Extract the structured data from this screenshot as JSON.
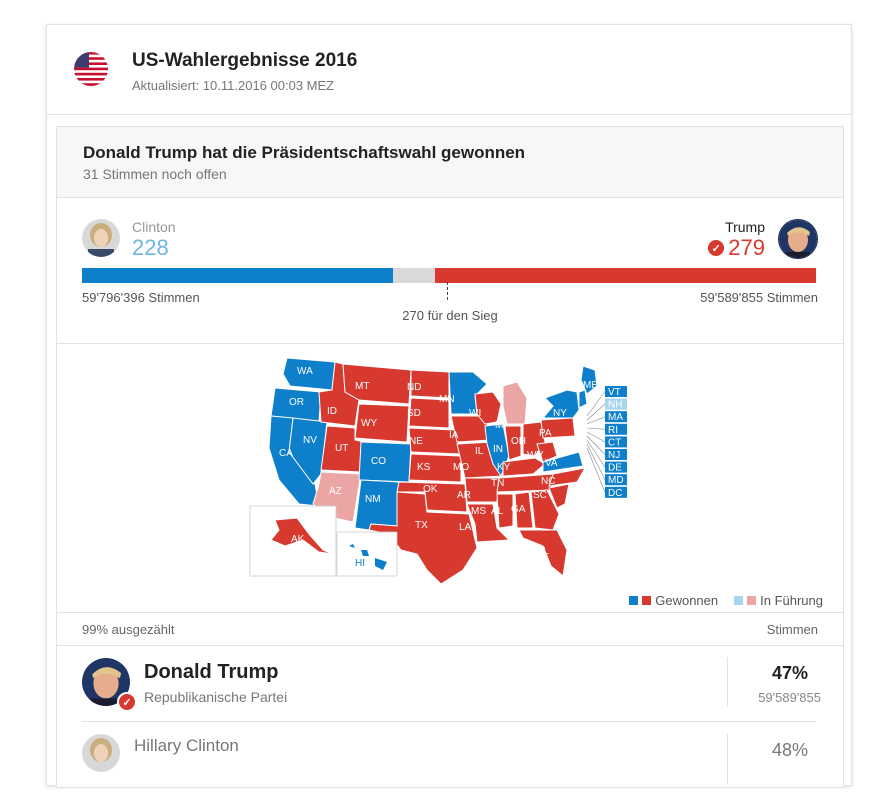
{
  "header": {
    "title": "US-Wahlergebnisse 2016",
    "updated": "Aktualisiert: 10.11.2016 00:03 MEZ"
  },
  "winner": {
    "headline": "Donald Trump hat die Präsidentschaftswahl gewonnen",
    "open_votes": "31 Stimmen noch offen"
  },
  "tally": {
    "clinton": {
      "name": "Clinton",
      "electoral": "228",
      "popular": "59'796'396 Stimmen"
    },
    "trump": {
      "name": "Trump",
      "electoral": "279",
      "popular": "59'589'855 Stimmen"
    },
    "to_win": "270 für den Sieg",
    "total_electoral": 538
  },
  "colors": {
    "dem": "#0d7fcb",
    "rep": "#d7392e",
    "dem_lead": "#a8d4f0",
    "rep_lead": "#eca5a5",
    "open": "#d9d9d9"
  },
  "map": {
    "states": [
      "WA",
      "OR",
      "CA",
      "NV",
      "ID",
      "MT",
      "WY",
      "UT",
      "AZ",
      "CO",
      "NM",
      "ND",
      "SD",
      "NE",
      "KS",
      "OK",
      "TX",
      "MN",
      "IA",
      "MO",
      "AR",
      "LA",
      "WI",
      "IL",
      "MI",
      "IN",
      "OH",
      "KY",
      "TN",
      "MS",
      "AL",
      "GA",
      "FL",
      "SC",
      "NC",
      "VA",
      "WV",
      "PA",
      "NY",
      "ME",
      "AK",
      "HI",
      "VT",
      "NH",
      "MA",
      "RI",
      "CT",
      "NJ",
      "DE",
      "MD",
      "DC"
    ],
    "small_states": [
      "VT",
      "NH",
      "MA",
      "RI",
      "CT",
      "NJ",
      "DE",
      "MD",
      "DC"
    ],
    "legend_won": "Gewonnen",
    "legend_lead": "In Führung"
  },
  "results": {
    "counted": "99% ausgezählt",
    "votes_header": "Stimmen",
    "rows": [
      {
        "name": "Donald Trump",
        "party": "Republikanische Partei",
        "pct": "47%",
        "votes": "59'589'855"
      },
      {
        "name": "Hillary Clinton",
        "party": "",
        "pct": "48%",
        "votes": ""
      }
    ]
  }
}
